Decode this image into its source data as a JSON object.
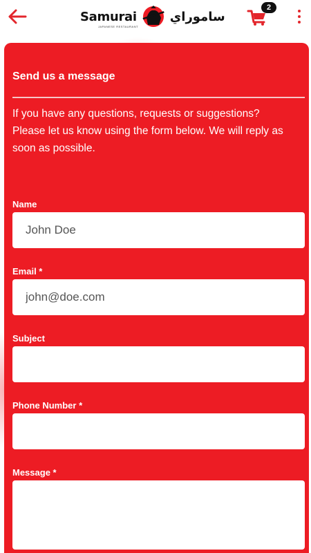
{
  "header": {
    "back_icon": "arrow-left-icon",
    "logo_en": "Samurai",
    "logo_subtitle": "JAPANESE RESTAURANT",
    "logo_ar": "ساموراي",
    "cart_icon": "cart-icon",
    "cart_count": "2",
    "more_icon": "more-vertical-icon",
    "accent_color": "#e3262c"
  },
  "form": {
    "title": "Send us a message",
    "intro": "If you have any questions, requests or suggestions? Please let us know using the form below. We will reply as soon as possible.",
    "background_color": "#ed1c24",
    "fields": {
      "name": {
        "label": "Name",
        "placeholder": "John Doe",
        "value": ""
      },
      "email": {
        "label": "Email *",
        "placeholder": "john@doe.com",
        "value": ""
      },
      "subject": {
        "label": "Subject",
        "placeholder": "",
        "value": ""
      },
      "phone": {
        "label": "Phone Number *",
        "placeholder": "",
        "value": ""
      },
      "message": {
        "label": "Message *",
        "placeholder": "",
        "value": ""
      }
    }
  }
}
